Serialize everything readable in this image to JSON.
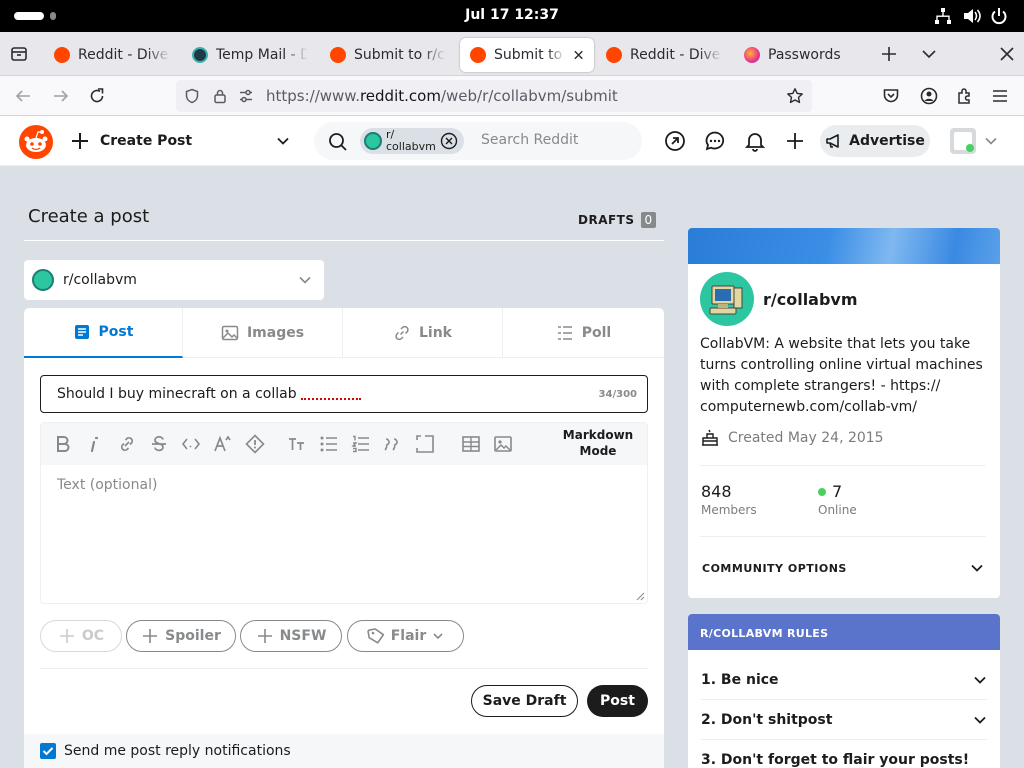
{
  "system": {
    "clock": "Jul 17  12:37"
  },
  "browser": {
    "tabs": [
      {
        "label": "Reddit - Dive into anything",
        "active": false
      },
      {
        "label": "Temp Mail - Disposable",
        "active": false
      },
      {
        "label": "Submit to r/collabvm",
        "active": false
      },
      {
        "label": "Submit to collabvm",
        "active": true
      },
      {
        "label": "Reddit - Dive into anything",
        "active": false
      },
      {
        "label": "Passwords",
        "active": false
      }
    ],
    "url_prefix": "https://www.",
    "url_domain": "reddit.com",
    "url_path": "/web/r/collabvm/submit"
  },
  "header": {
    "create_post": "Create Post",
    "search_chip_line1": "r/",
    "search_chip_line2": "collabvm",
    "search_placeholder": "Search Reddit",
    "advertise": "Advertise"
  },
  "main": {
    "title": "Create a post",
    "drafts_label": "DRAFTS",
    "drafts_count": "0",
    "community": "r/collabvm",
    "tabs": [
      {
        "label": "Post"
      },
      {
        "label": "Images"
      },
      {
        "label": "Link"
      },
      {
        "label": "Poll"
      }
    ],
    "title_value": "Should I buy minecraft on a collab",
    "title_counter": "34/300",
    "markdown_line1": "Markdown",
    "markdown_line2": "Mode",
    "body_placeholder": "Text (optional)",
    "tags": {
      "oc": "OC",
      "spoiler": "Spoiler",
      "nsfw": "NSFW",
      "flair": "Flair"
    },
    "save_draft": "Save Draft",
    "post_button": "Post",
    "notify_label": "Send me post reply notifications"
  },
  "sidebar": {
    "community_name": "r/collabvm",
    "description": "CollabVM: A website that lets you take turns controlling online virtual machines with complete strangers! - https:// computernewb.com/collab-vm/",
    "created": "Created May 24, 2015",
    "members_count": "848",
    "members_label": "Members",
    "online_count": "7",
    "online_label": "Online",
    "community_options": "COMMUNITY OPTIONS",
    "rules_header": "R/COLLABVM RULES",
    "rules": [
      {
        "label": "1. Be nice"
      },
      {
        "label": "2. Don't shitpost"
      },
      {
        "label": "3. Don't forget to flair your posts!"
      }
    ]
  },
  "colors": {
    "accent": "#0079d3",
    "reddit_orange": "#ff4500",
    "rules_header": "#5a74cc",
    "online_dot": "#46d160"
  }
}
